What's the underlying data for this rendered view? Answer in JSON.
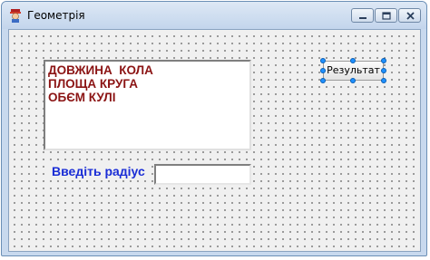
{
  "window": {
    "title": "Геометрія"
  },
  "memo": {
    "lines": [
      "ДОВЖИНА  КОЛА",
      "ПЛОЩА КРУГА",
      "ОБЄМ КУЛІ"
    ]
  },
  "radius": {
    "label": "Введіть радіус",
    "value": ""
  },
  "result_button": {
    "label": "Результат"
  },
  "colors": {
    "memo_text": "#8b1414",
    "label_text": "#1a2dd6",
    "selection_handle": "#1e90ff"
  },
  "icons": {
    "app": "app-icon",
    "minimize": "minimize-icon",
    "maximize": "maximize-icon",
    "close": "close-icon"
  }
}
